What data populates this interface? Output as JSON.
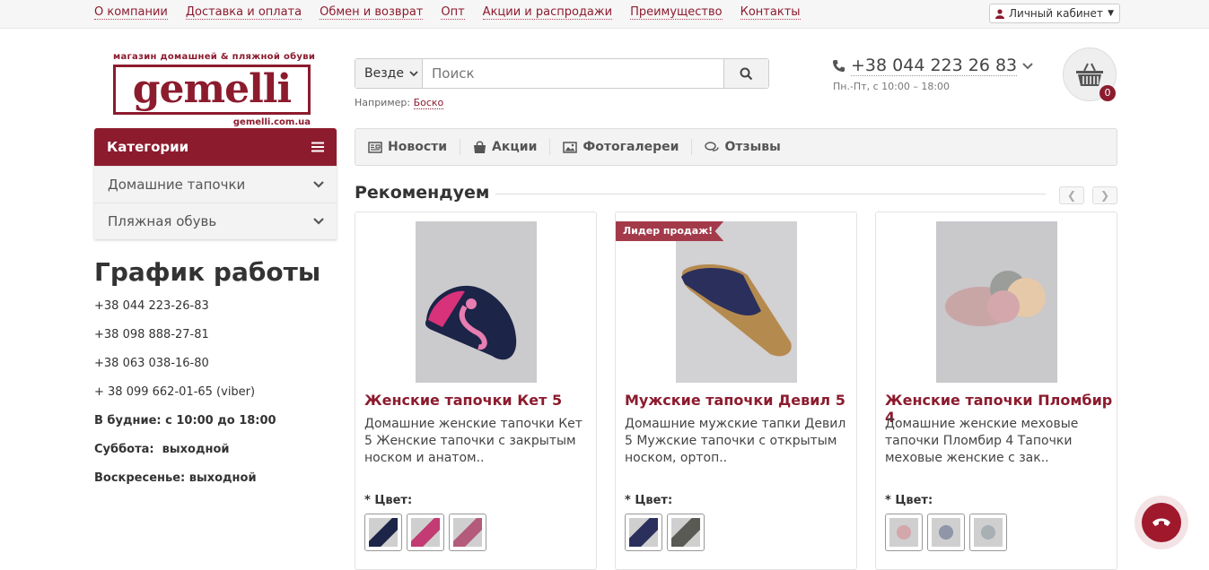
{
  "topnav": [
    "О компании",
    "Доставка и оплата",
    "Обмен и возврат",
    "Опт",
    "Акции и распродажи",
    "Преимущество",
    "Контакты"
  ],
  "account": {
    "label": "Личный кабинет"
  },
  "logo": {
    "tagline": "магазин домашней & пляжной обуви",
    "word": "gemelli",
    "url": "gemelli.com.ua"
  },
  "search": {
    "scope": "Везде",
    "placeholder": "Поиск",
    "example_prefix": "Например:",
    "example_link": "Боско"
  },
  "contact": {
    "phone": "+38 044 223 26 83",
    "hours": "Пн.-Пт, с 10:00 – 18:00"
  },
  "cart": {
    "count": "0"
  },
  "categories": {
    "title": "Категории",
    "items": [
      "Домашние тапочки",
      "Пляжная обувь"
    ]
  },
  "schedule": {
    "title": "График работы",
    "phones": [
      "+38 044 223-26-83",
      "+38 098 888-27-81",
      "+38 063 038-16-80",
      "+ 38 099 662-01-65 (viber)"
    ],
    "weekdays": "В будние: с 10:00 до 18:00",
    "saturday": "Суббота:  выходной",
    "sunday": "Воскресенье: выходной"
  },
  "infobar": [
    "Новости",
    "Акции",
    "Фотогалереи",
    "Отзывы"
  ],
  "recommend": {
    "title": "Рекомендуем"
  },
  "products": [
    {
      "name": "Женские тапочки Кет 5",
      "desc": "Домашние женские тапочки Кет 5     Женские тапочки с закрытым носком и анатом..",
      "color_label": "* Цвет:",
      "badge": "",
      "swatches": 3
    },
    {
      "name": "Мужские тапочки Девил 5",
      "desc": "Домашние мужские тапки Девил 5     Мужские тапочки с открытым носком, ортоп..",
      "color_label": "* Цвет:",
      "badge": "Лидер продаж!",
      "swatches": 2
    },
    {
      "name": "Женские тапочки Пломбир 4",
      "desc": "Домашние женские меховые тапочки Пломбир 4     Тапочки меховые женские с зак..",
      "color_label": "* Цвет:",
      "badge": "",
      "swatches": 3
    }
  ],
  "colors": {
    "brand": "#8c1b2e"
  }
}
